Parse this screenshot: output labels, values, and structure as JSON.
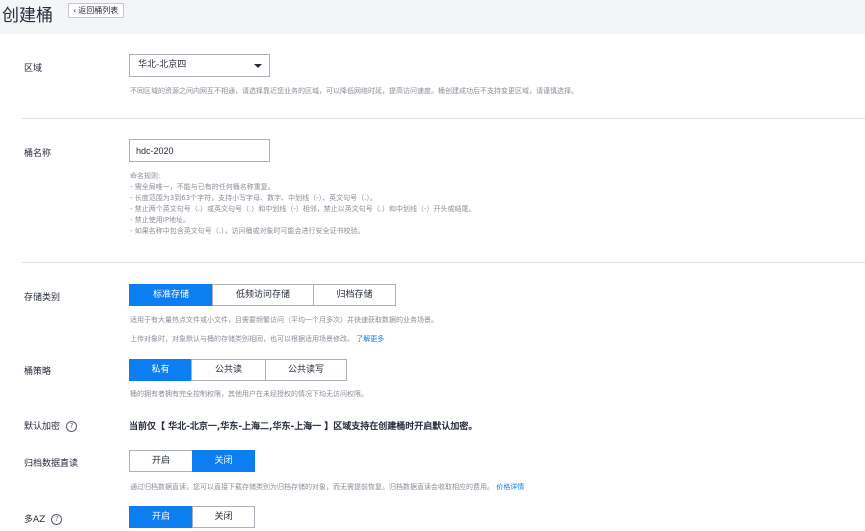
{
  "header": {
    "title": "创建桶",
    "back_label": "返回桶列表"
  },
  "region": {
    "label": "区域",
    "selected": "华北-北京四",
    "hint": "不同区域的资源之间内网互不相通，请选择靠近您业务的区域，可以降低网络时延，提高访问速度。桶创建成功后不支持变更区域，请谨慎选择。"
  },
  "bucket_name": {
    "label": "桶名称",
    "value": "hdc-2020",
    "rules": [
      "命名规则:",
      "- 需全局唯一，不能与已有的任何桶名称重复。",
      "- 长度范围为3到63个字符，支持小写字母、数字、中划线（-）、英文句号（.）。",
      "- 禁止两个英文句号（.）或英文句号（.）和中划线（-）相邻，禁止以英文句号（.）和中划线（-）开头或结尾。",
      "- 禁止使用IP地址。",
      "- 如果名称中包含英文句号（.），访问桶或对象时可能会进行安全证书校验。"
    ]
  },
  "storage_class": {
    "label": "存储类别",
    "options": [
      "标准存储",
      "低频访问存储",
      "归档存储"
    ],
    "selected": "标准存储",
    "hint1": "适用于有大量热点文件或小文件，且需要频繁访问（平均一个月多次）并快速获取数据的业务场景。",
    "hint2": "上传对象时，对象默认与桶的存储类别相同，也可以根据适用场景修改。",
    "learn_more": "了解更多"
  },
  "bucket_policy": {
    "label": "桶策略",
    "options": [
      "私有",
      "公共读",
      "公共读写"
    ],
    "selected": "私有",
    "hint": "桶的拥有者拥有完全控制权限，其他用户在未经授权的情况下均无访问权限。"
  },
  "default_encryption": {
    "label": "默认加密",
    "notice": "当前仅【 华北-北京一,华东-上海二,华东-上海一 】区域支持在创建桶时开启默认加密。"
  },
  "archive_direct_read": {
    "label": "归档数据直读",
    "options": [
      "开启",
      "关闭"
    ],
    "selected": "关闭",
    "hint": "通过归档数据直读，您可以直接下载存储类别为归档存储的对象，而无需提前恢复。归档数据直读会收取相应的费用。",
    "price_link": "价格详情"
  },
  "multi_az": {
    "label": "多AZ",
    "options": [
      "开启",
      "关闭"
    ],
    "selected": "开启"
  },
  "icons": {
    "back": "chevron-left-icon",
    "dropdown": "caret-down-icon",
    "help": "question-circle-icon"
  },
  "colors": {
    "accent": "#0d7ef2",
    "page_bg": "#f4f5f7",
    "hint_text": "#8a8e99"
  }
}
